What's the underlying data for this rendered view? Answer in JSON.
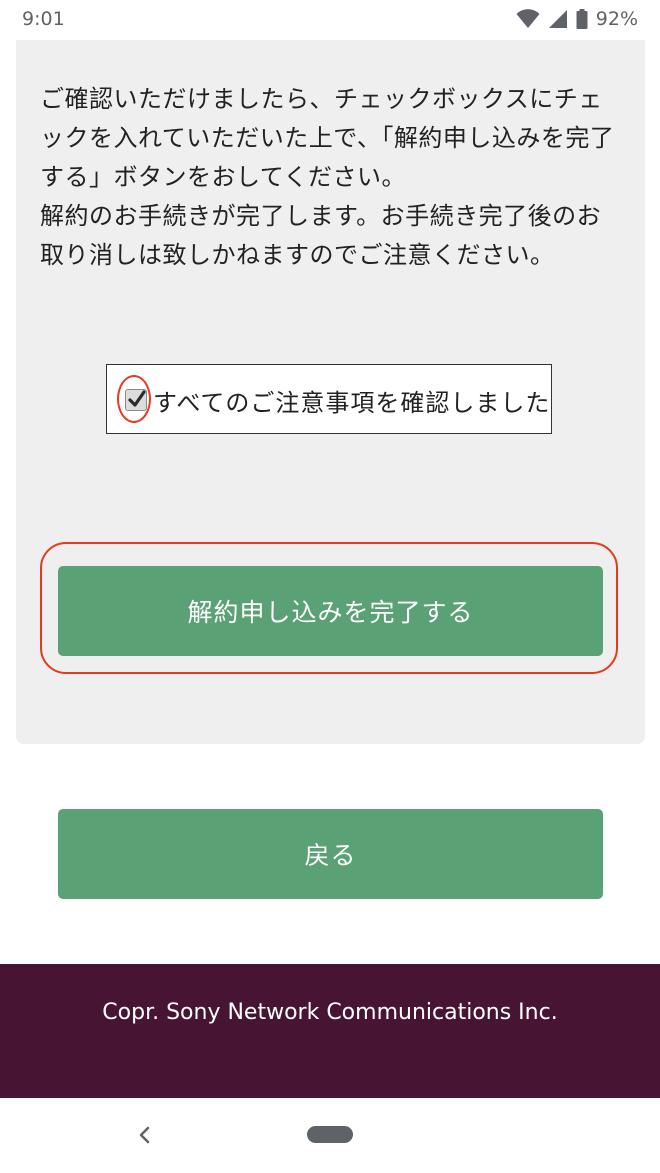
{
  "status_bar": {
    "time": "9:01",
    "battery": "92%",
    "icons": [
      "wifi-icon",
      "signal-icon",
      "battery-icon"
    ]
  },
  "notice": {
    "paragraph1": "ご確認いただけましたら、チェックボックスにチェックを入れていただいた上で、「解約申し込みを完了する」ボタンをおしてください。",
    "paragraph2": "解約のお手続きが完了します。お手続き完了後のお取り消しは致しかねますのでご注意ください。"
  },
  "confirm": {
    "checked": true,
    "label": "すべてのご注意事項を確認しました"
  },
  "buttons": {
    "complete_label": "解約申し込みを完了する",
    "back_label": "戻る"
  },
  "footer": {
    "copyright": "Copr. Sony Network Communications Inc."
  },
  "colors": {
    "button_green": "#5ba176",
    "footer_bg": "#471533",
    "highlight_red": "#e8391f",
    "card_bg": "#efefef"
  }
}
